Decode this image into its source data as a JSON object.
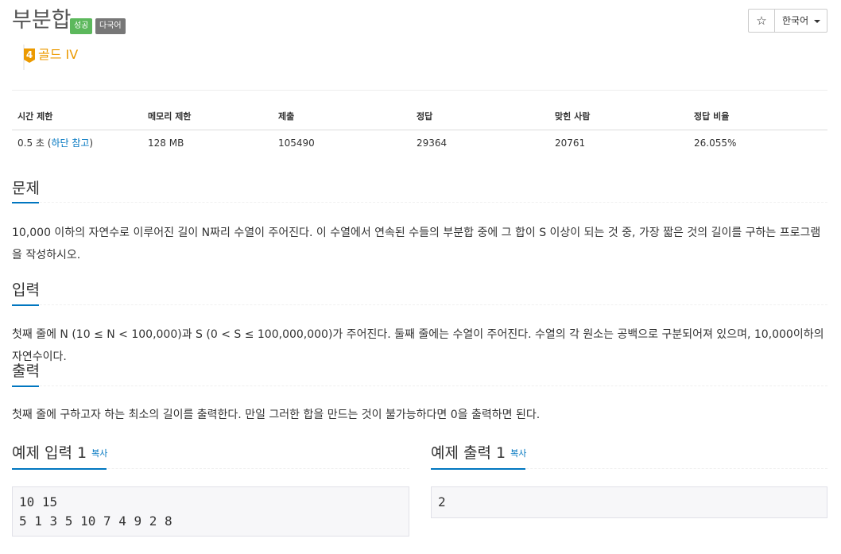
{
  "problem": {
    "title": "부분합",
    "labels": {
      "success": "성공",
      "multilang": "다국어"
    },
    "tier_number": "4",
    "tier_name": "골드 IV"
  },
  "toolbar": {
    "star_label": "☆",
    "language_label": "한국어"
  },
  "stats": {
    "headers": [
      "시간 제한",
      "메모리 제한",
      "제출",
      "정답",
      "맞힌 사람",
      "정답 비율"
    ],
    "time_limit": "0.5 초 (",
    "time_link": "하단 참고",
    "time_close": ")",
    "memory": "128 MB",
    "submissions": "105490",
    "accepted": "29364",
    "solved_users": "20761",
    "ratio": "26.055%"
  },
  "sections": {
    "problem_title": "문제",
    "problem_text": "10,000 이하의 자연수로 이루어진 길이 N짜리 수열이 주어진다. 이 수열에서 연속된 수들의 부분합 중에 그 합이 S 이상이 되는 것 중, 가장 짧은 것의 길이를 구하는 프로그램을 작성하시오.",
    "input_title": "입력",
    "input_text": "첫째 줄에 N (10 ≤ N < 100,000)과 S (0 < S ≤ 100,000,000)가 주어진다. 둘째 줄에는 수열이 주어진다. 수열의 각 원소는 공백으로 구분되어져 있으며, 10,000이하의 자연수이다.",
    "output_title": "출력",
    "output_text": "첫째 줄에 구하고자 하는 최소의 길이를 출력한다. 만일 그러한 합을 만드는 것이 불가능하다면 0을 출력하면 된다."
  },
  "samples": {
    "input_title": "예제 입력 1",
    "output_title": "예제 출력 1",
    "copy_label": "복사",
    "input_value": "10 15\n5 1 3 5 10 7 4 9 2 8",
    "output_value": "2"
  }
}
